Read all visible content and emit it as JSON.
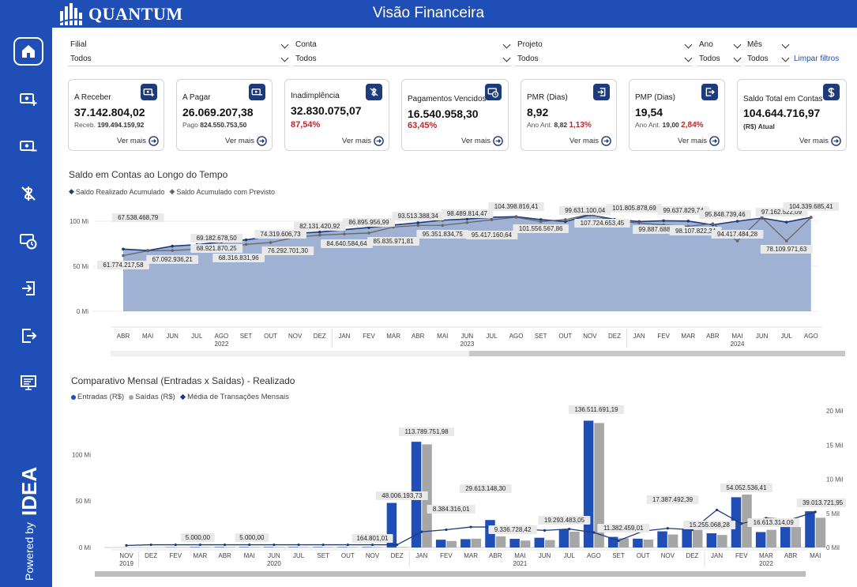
{
  "header": {
    "brand": "QUANTUM",
    "title": "Visão Financeira"
  },
  "sidebar": {
    "items": [
      {
        "name": "home-icon"
      },
      {
        "name": "receive-money-icon"
      },
      {
        "name": "pay-money-icon"
      },
      {
        "name": "default-icon"
      },
      {
        "name": "overdue-icon"
      },
      {
        "name": "login-icon"
      },
      {
        "name": "logout-icon"
      },
      {
        "name": "monitor-icon"
      }
    ],
    "powered_by": "Powered by",
    "powered_brand": "IDEA"
  },
  "filters": {
    "filial": {
      "label": "Filial",
      "value": "Todos"
    },
    "conta": {
      "label": "Conta",
      "value": "Todos"
    },
    "projeto": {
      "label": "Projeto",
      "value": "Todos"
    },
    "ano": {
      "label": "Ano",
      "value": "Todos"
    },
    "mes": {
      "label": "Mês",
      "value": "Todos"
    },
    "clear": "Limpar filtros"
  },
  "cards": [
    {
      "title": "A Receber",
      "value": "37.142.804,02",
      "sub_label": "Receb.",
      "sub_value": "199.494.159,92",
      "more": "Ver mais",
      "icon": "receive-money-icon"
    },
    {
      "title": "A Pagar",
      "value": "26.069.207,38",
      "sub_label": "Pago",
      "sub_value": "824.550.753,50",
      "more": "Ver mais",
      "icon": "pay-money-icon"
    },
    {
      "title": "Inadimplência",
      "value": "32.830.075,07",
      "pct": "87,54%",
      "more": "Ver mais",
      "icon": "default-icon"
    },
    {
      "title": "Pagamentos Vencidos",
      "value": "16.540.958,30",
      "pct": "63,45%",
      "more": "Ver mais",
      "icon": "overdue-icon"
    },
    {
      "title": "PMR (Dias)",
      "value": "8,92",
      "sub_label": "Ano Ant.",
      "sub_value": "8,82",
      "pct": "1,13%",
      "more": "Ver mais",
      "icon": "login-icon"
    },
    {
      "title": "PMP (Dias)",
      "value": "19,54",
      "sub_label": "Ano Ant.",
      "sub_value": "19,00",
      "pct": "2,84%",
      "more": "Ver mais",
      "icon": "logout-icon"
    },
    {
      "title": "Saldo Total em Contas",
      "value": "104.644.716,97",
      "sub_bold": "(R$) Atual",
      "more": "Ver mais",
      "icon": "dollar-icon"
    }
  ],
  "colors": {
    "brand": "#1f4fb6",
    "dark_blue": "#1d3a7a",
    "area": "#9fb2d4",
    "gray_line": "#666666",
    "entradas": "#1f4fb6",
    "saidas": "#a6a6a6",
    "red": "#c0272d"
  },
  "chart_data": [
    {
      "type": "area",
      "title": "Saldo em Contas ao Longo do Tempo",
      "legend": [
        "Saldo Realizado Acumulado",
        "Saldo Acumulado com Previsto"
      ],
      "y_ticks": [
        "100 Mi",
        "50 Mi",
        "0 Mi"
      ],
      "ylim": [
        0,
        120
      ],
      "categories": [
        "ABR",
        "MAI",
        "JUN",
        "JUL",
        "AGO",
        "SET",
        "OUT",
        "NOV",
        "DEZ",
        "JAN",
        "FEV",
        "MAR",
        "ABR",
        "MAI",
        "JUN",
        "JUL",
        "AGO",
        "SET",
        "OUT",
        "NOV",
        "DEZ",
        "JAN",
        "FEV",
        "MAR",
        "ABR",
        "MAI",
        "JUN",
        "JUL",
        "AGO"
      ],
      "years": [
        {
          "label": "2022",
          "index": 4
        },
        {
          "label": "2023",
          "index": 14
        },
        {
          "label": "2024",
          "index": 25
        }
      ],
      "series": [
        {
          "name": "Saldo Realizado Acumulado",
          "values": [
            69.0,
            67.5,
            72.3,
            74.0,
            77.0,
            79.3,
            83.2,
            86.4,
            88.0,
            90.6,
            93.0,
            95.8,
            98.3,
            101.2,
            102.5,
            104.4,
            105.0,
            101.8,
            99.6,
            107.0,
            102.0,
            99.6,
            100.5,
            100.2,
            96.0,
            100.0,
            103.5,
            99.0,
            104.3
          ]
        },
        {
          "name": "Saldo Acumulado com Previsto",
          "values": [
            61.8,
            67.1,
            67.5,
            68.9,
            68.3,
            74.3,
            76.3,
            82.1,
            84.6,
            85.8,
            86.9,
            93.5,
            95.4,
            95.4,
            98.5,
            101.6,
            104.4,
            99.6,
            101.8,
            107.7,
            99.9,
            98.1,
            95.8,
            94.4,
            97.2,
            78.1,
            104.3,
            78.1,
            104.3
          ]
        }
      ],
      "labels": [
        {
          "text": "67.538.468,79"
        },
        {
          "text": "61.774.217,58"
        },
        {
          "text": "67.092.936,21"
        },
        {
          "text": "69.182.678,50"
        },
        {
          "text": "68.921.870,25"
        },
        {
          "text": "68.316.831,96"
        },
        {
          "text": "74.319.606,73"
        },
        {
          "text": "76.292.701,30"
        },
        {
          "text": "82.131.420,92"
        },
        {
          "text": "84.640.584,64"
        },
        {
          "text": "86.895.956,99"
        },
        {
          "text": "85.835.971,81"
        },
        {
          "text": "93.513.388,34"
        },
        {
          "text": "95.351.834,75"
        },
        {
          "text": "98.489.814,47"
        },
        {
          "text": "95.417.160,64"
        },
        {
          "text": "104.398.816,41"
        },
        {
          "text": "101.556.567,86"
        },
        {
          "text": "99.631.100,04"
        },
        {
          "text": "107.724.653,45"
        },
        {
          "text": "101.805.878,69"
        },
        {
          "text": "99.887.688,15"
        },
        {
          "text": "99.637.829,74"
        },
        {
          "text": "98.107.822,34"
        },
        {
          "text": "95.848.739,46"
        },
        {
          "text": "94.417.484,28"
        },
        {
          "text": "97.162.522,09"
        },
        {
          "text": "78.109.971,63"
        },
        {
          "text": "104.339.685,41"
        }
      ]
    },
    {
      "type": "bar",
      "title": "Comparativo Mensal (Entradas x Saídas) - Realizado",
      "legend": [
        "Entradas (R$)",
        "Saídas (R$)",
        "Média de Transações Mensais"
      ],
      "y_ticks_left": [
        "100 Mi",
        "50 Mi",
        "0 Mi"
      ],
      "y_ticks_right": [
        "20 Mil",
        "15 Mil",
        "10 Mil",
        "5 Mil",
        "0 Mil"
      ],
      "ylim": [
        0,
        150
      ],
      "ylim_right": [
        0,
        20
      ],
      "categories": [
        "NOV",
        "DEZ",
        "FEV",
        "MAR",
        "ABR",
        "MAI",
        "JUN",
        "JUL",
        "SET",
        "OUT",
        "NOV",
        "DEZ",
        "JAN",
        "FEV",
        "MAR",
        "ABR",
        "MAI",
        "JUN",
        "JUL",
        "AGO",
        "SET",
        "OUT",
        "NOV",
        "DEZ",
        "JAN",
        "FEV",
        "MAR",
        "ABR",
        "MAI"
      ],
      "years": [
        {
          "label": "2019",
          "index": 0
        },
        {
          "label": "2020",
          "index": 6
        },
        {
          "label": "2021",
          "index": 16
        },
        {
          "label": "2022",
          "index": 26
        }
      ],
      "series": [
        {
          "name": "Entradas (R$)",
          "values": [
            0,
            0,
            0.3,
            0.5,
            0.5,
            0.5,
            0.5,
            0.5,
            0.5,
            0.5,
            0.5,
            48.0,
            113.8,
            8.4,
            9.0,
            29.6,
            9.3,
            10.5,
            19.3,
            136.5,
            11.4,
            9.5,
            17.4,
            20.0,
            15.3,
            54.1,
            16.6,
            22.0,
            39.0
          ]
        },
        {
          "name": "Saídas (R$)",
          "values": [
            0,
            0,
            0.3,
            0.5,
            0.5,
            0.5,
            0.5,
            0.5,
            0.5,
            0.5,
            0.5,
            0.5,
            111.0,
            7.0,
            9.5,
            12.0,
            7.5,
            8.0,
            17.0,
            134.0,
            10.0,
            8.5,
            14.0,
            19.0,
            13.5,
            57.0,
            19.0,
            22.0,
            32.0
          ]
        },
        {
          "name": "Média de Transações Mensais",
          "values": [
            0.3,
            0.4,
            0.4,
            0.4,
            0.4,
            0.4,
            0.4,
            0.4,
            0.4,
            0.4,
            0.4,
            0.4,
            2.3,
            2.6,
            3.0,
            3.0,
            2.7,
            2.5,
            2.7,
            2.2,
            1.0,
            2.4,
            2.8,
            2.6,
            5.5,
            3.5,
            4.3,
            4.1,
            5.2
          ]
        }
      ],
      "labels": [
        {
          "text": "5.000,00"
        },
        {
          "text": "5.000,00"
        },
        {
          "text": "164.801,01"
        },
        {
          "text": "48.006.193,73"
        },
        {
          "text": "113.789.751,98"
        },
        {
          "text": "8.384.316,01"
        },
        {
          "text": "29.613.148,30"
        },
        {
          "text": "9.336.728,42"
        },
        {
          "text": "19.293.483,05"
        },
        {
          "text": "136.511.691,19"
        },
        {
          "text": "11.382.459,01"
        },
        {
          "text": "17.387.492,39"
        },
        {
          "text": "15.255.068,28"
        },
        {
          "text": "54.052.536,41"
        },
        {
          "text": "16.613.314,09"
        },
        {
          "text": "39.013.721,95"
        }
      ]
    }
  ]
}
